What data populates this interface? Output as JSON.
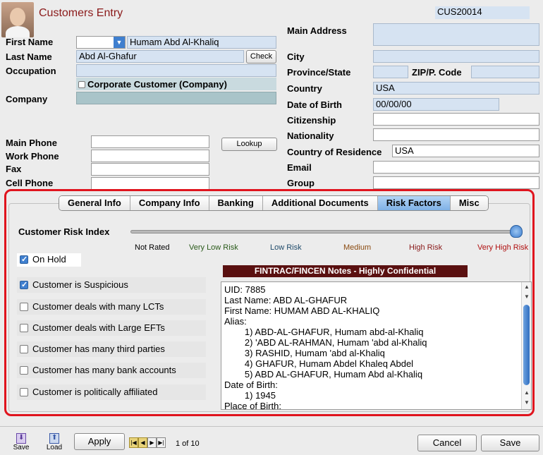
{
  "header": {
    "title": "Customers Entry",
    "customer_id": "CUS20014"
  },
  "left_form": {
    "first_name_label": "First Name",
    "first_name_value": "Humam Abd Al-Khaliq",
    "last_name_label": "Last Name",
    "last_name_value": "Abd Al-Ghafur",
    "check_button": "Check",
    "occupation_label": "Occupation",
    "occupation_value": "",
    "corporate_label": "Corporate Customer (Company)",
    "company_label": "Company",
    "company_value": "",
    "main_phone_label": "Main Phone",
    "work_phone_label": "Work Phone",
    "fax_label": "Fax",
    "cell_phone_label": "Cell Phone",
    "lookup_button": "Lookup"
  },
  "right_form": {
    "main_address_label": "Main Address",
    "city_label": "City",
    "province_label": "Province/State",
    "zip_label": "ZIP/P. Code",
    "country_label": "Country",
    "country_value": "USA",
    "dob_label": "Date of Birth",
    "dob_value": "00/00/00",
    "citizenship_label": "Citizenship",
    "nationality_label": "Nationality",
    "residence_label": "Country of Residence",
    "residence_value": "USA",
    "email_label": "Email",
    "group_label": "Group"
  },
  "tabs": [
    {
      "label": "General Info",
      "active": false
    },
    {
      "label": "Company Info",
      "active": false
    },
    {
      "label": "Banking",
      "active": false
    },
    {
      "label": "Additional Documents",
      "active": false
    },
    {
      "label": "Risk Factors",
      "active": true
    },
    {
      "label": "Misc",
      "active": false
    }
  ],
  "risk": {
    "index_label": "Customer Risk Index",
    "slider_level": 1.0,
    "scale": [
      {
        "label": "Not Rated",
        "color": "#000000"
      },
      {
        "label": "Very Low Risk",
        "color": "#2a5a1a"
      },
      {
        "label": "Low Risk",
        "color": "#1f4a6a"
      },
      {
        "label": "Medium",
        "color": "#8a4a10"
      },
      {
        "label": "High Risk",
        "color": "#8a1a1a"
      },
      {
        "label": "Very High Risk",
        "color": "#b01010"
      }
    ],
    "factors": [
      {
        "label": "On Hold",
        "checked": true
      },
      {
        "label": "Customer is Suspicious",
        "checked": true
      },
      {
        "label": "Customer deals with many LCTs",
        "checked": false
      },
      {
        "label": "Customer deals with Large EFTs",
        "checked": false
      },
      {
        "label": "Customer has many third parties",
        "checked": false
      },
      {
        "label": "Customer has many bank accounts",
        "checked": false
      },
      {
        "label": "Customer is politically affiliated",
        "checked": false
      }
    ]
  },
  "notes": {
    "header": "FINTRAC/FINCEN Notes - Highly Confidential",
    "lines": [
      "UID: 7885",
      "Last Name: ABD AL-GHAFUR",
      "First Name: HUMAM ABD AL-KHALIQ",
      "Alias:",
      "        1) ABD-AL-GHAFUR, Humam abd-al-Khaliq",
      "        2) 'ABD AL-RAHMAN, Humam 'abd al-Khaliq",
      "        3) RASHID, Humam 'abd al-Khaliq",
      "        4) GHAFUR, Humam Abdel Khaleq Abdel",
      "        5) ABD AL-GHAFUR, Humam Abd al-Khaliq",
      "Date of Birth:",
      "        1) 1945",
      "Place of Birth:"
    ]
  },
  "footer": {
    "save_icon_label": "Save",
    "load_icon_label": "Load",
    "apply_button": "Apply",
    "pager_text": "1 of 10",
    "cancel_button": "Cancel",
    "save_button": "Save"
  },
  "colors": {
    "title": "#8b1a1a",
    "notes_header_bg": "#5a1010",
    "highlight_border": "#e0141e",
    "field_blue": "#d6e3f2"
  }
}
